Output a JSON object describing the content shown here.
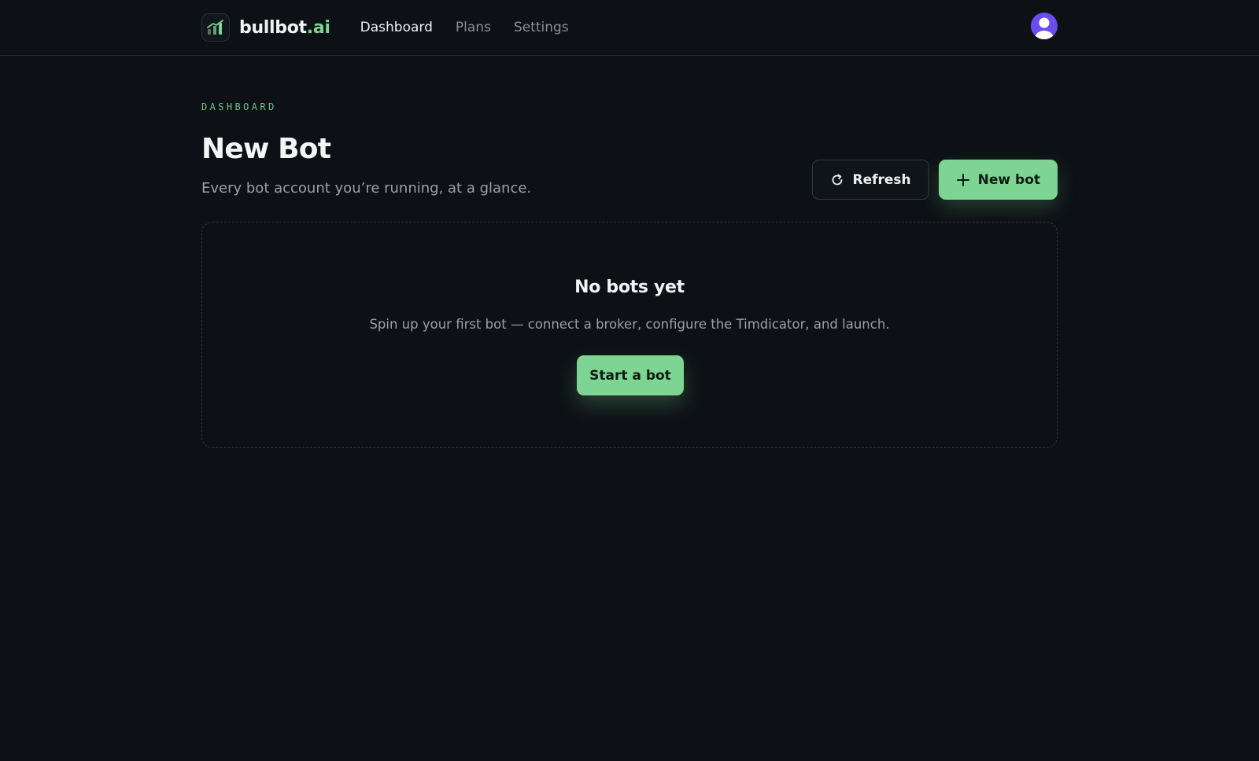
{
  "header": {
    "brand_name": "bullbot",
    "brand_suffix": ".ai",
    "nav": [
      {
        "label": "Dashboard",
        "active": true
      },
      {
        "label": "Plans",
        "active": false
      },
      {
        "label": "Settings",
        "active": false
      }
    ],
    "logo_icon": "chart-bars-icon",
    "avatar_icon": "user-avatar-icon"
  },
  "page": {
    "eyebrow": "DASHBOARD",
    "title": "New Bot",
    "subtitle": "Every bot account you’re running, at a glance."
  },
  "actions": {
    "refresh_label": "Refresh",
    "refresh_icon": "refresh-icon",
    "new_bot_label": "New bot",
    "new_bot_icon": "plus-icon"
  },
  "empty_state": {
    "title": "No bots yet",
    "text": "Spin up your first bot — connect a broker, configure the Timdicator, and launch.",
    "cta_label": "Start a bot"
  },
  "colors": {
    "background": "#0d1115",
    "accent": "#7ed492",
    "avatar": "#6b4cf0"
  }
}
